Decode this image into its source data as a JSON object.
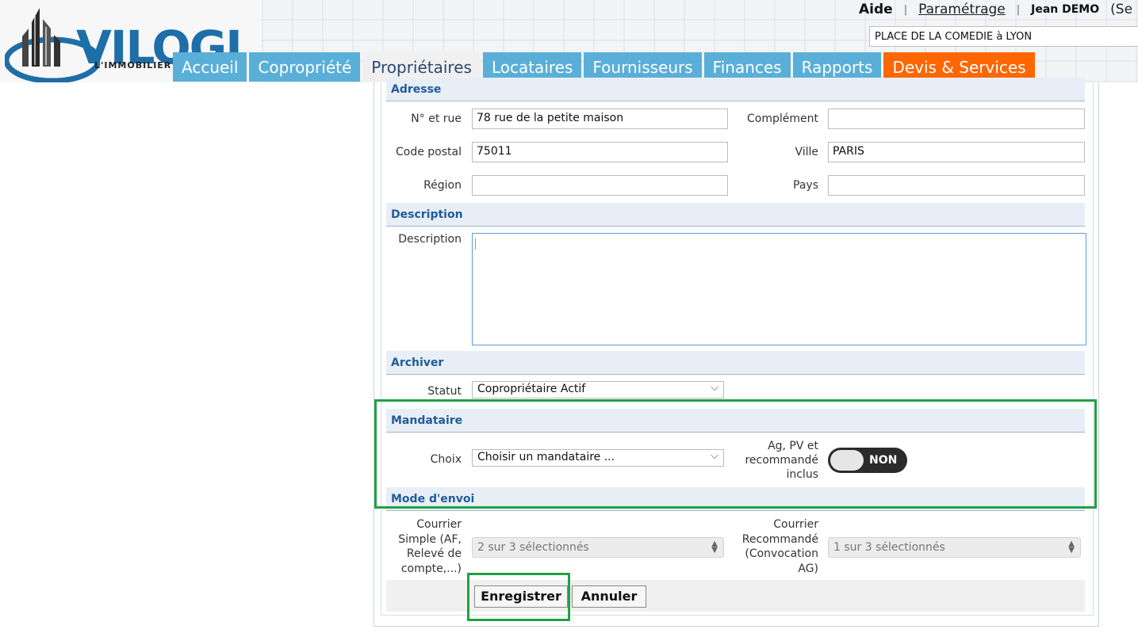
{
  "header": {
    "logo_text": "VILOGI",
    "logo_sub": "L'IMMOBILIER",
    "links": {
      "aide": "Aide",
      "separator": "|",
      "parametrage": "Paramétrage",
      "user": "Jean DEMO",
      "seq": "(Se"
    },
    "building": "PLACE DE LA COMEDIE à LYON"
  },
  "nav": {
    "tabs": [
      {
        "label": "Accueil"
      },
      {
        "label": "Copropriété"
      },
      {
        "label": "Propriétaires"
      },
      {
        "label": "Locataires"
      },
      {
        "label": "Fournisseurs"
      },
      {
        "label": "Finances"
      },
      {
        "label": "Rapports"
      },
      {
        "label": "Devis & Services"
      }
    ]
  },
  "form": {
    "sections": {
      "adresse": "Adresse",
      "description": "Description",
      "archiver": "Archiver",
      "mandataire": "Mandataire",
      "mode_envoi": "Mode d'envoi"
    },
    "adresse": {
      "rue_label": "N° et rue",
      "rue_value": "78 rue de la petite maison",
      "complement_label": "Complément",
      "complement_value": "",
      "cp_label": "Code postal",
      "cp_value": "75011",
      "ville_label": "Ville",
      "ville_value": "PARIS",
      "region_label": "Région",
      "region_value": "",
      "pays_label": "Pays",
      "pays_value": ""
    },
    "description": {
      "label": "Description",
      "value": ""
    },
    "archiver": {
      "statut_label": "Statut",
      "statut_value": "Copropriétaire Actif"
    },
    "mandataire": {
      "choix_label": "Choix",
      "choix_value": "Choisir un mandataire ...",
      "ag_label_1": "Ag, PV et",
      "ag_label_2": "recommandé",
      "ag_label_3": "inclus",
      "toggle_text": "NON"
    },
    "mode_envoi": {
      "simple_label": [
        "Courrier",
        "Simple (AF,",
        "Relevé de",
        "compte,...)"
      ],
      "simple_value": "2 sur 3 sélectionnés",
      "recommande_label": [
        "Courrier",
        "Recommandé",
        "(Convocation",
        "AG)"
      ],
      "recommande_value": "1 sur 3 sélectionnés"
    },
    "buttons": {
      "save": "Enregistrer",
      "cancel": "Annuler"
    }
  },
  "colors": {
    "tab_blue": "#5aafd8",
    "tab_orange": "#ff6600",
    "section_blue": "#1f5c99",
    "highlight_green": "#22a045"
  }
}
